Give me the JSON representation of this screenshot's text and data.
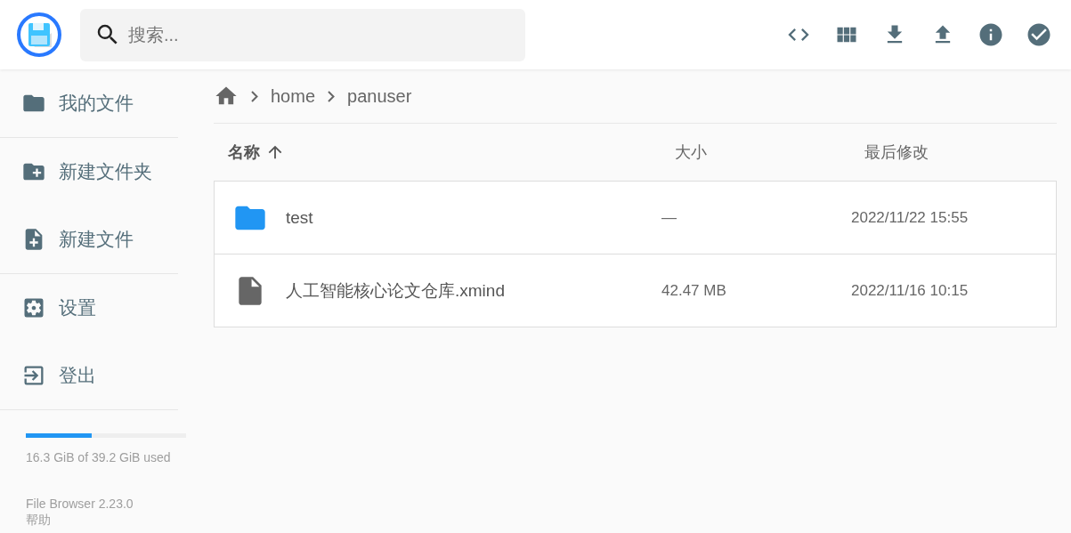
{
  "search": {
    "placeholder": "搜索..."
  },
  "sidebar": {
    "groups": [
      [
        {
          "label": "我的文件"
        }
      ],
      [
        {
          "label": "新建文件夹"
        },
        {
          "label": "新建文件"
        }
      ],
      [
        {
          "label": "设置"
        },
        {
          "label": "登出"
        }
      ]
    ]
  },
  "storage": {
    "level": 0.41,
    "text": "16.3 GiB of 39.2 GiB used"
  },
  "footer": {
    "version": "File Browser 2.23.0",
    "help": "帮助"
  },
  "breadcrumb": [
    "home",
    "panuser"
  ],
  "table": {
    "columns": [
      {
        "label": "名称",
        "sorted": true
      },
      {
        "label": "大小",
        "sorted": false
      },
      {
        "label": "最后修改",
        "sorted": false
      }
    ],
    "rows": [
      {
        "kind": "folder",
        "name": "test",
        "size": "—",
        "modified": "2022/11/22 15:55"
      },
      {
        "kind": "file",
        "name": "人工智能核心论文仓库.xmind",
        "size": "42.47 MB",
        "modified": "2022/11/16 10:15"
      }
    ]
  }
}
